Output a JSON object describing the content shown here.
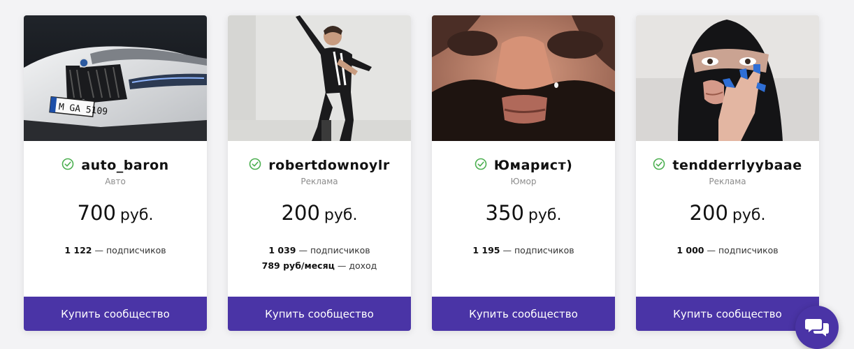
{
  "currency": "руб.",
  "button_label": "Купить сообщество",
  "cards": [
    {
      "name": "auto_baron",
      "category": "Авто",
      "price": "700",
      "stats": [
        {
          "value": "1 122",
          "label": "— подписчиков"
        }
      ]
    },
    {
      "name": "robertdownoylr",
      "category": "Реклама",
      "price": "200",
      "stats": [
        {
          "value": "1 039",
          "label": "— подписчиков"
        },
        {
          "value": "789 руб/месяц",
          "label": "— доход"
        }
      ]
    },
    {
      "name": "Юмарист)",
      "category": "Юмор",
      "price": "350",
      "stats": [
        {
          "value": "1 195",
          "label": "— подписчиков"
        }
      ]
    },
    {
      "name": "tendderrlyybaae",
      "category": "Реклама",
      "price": "200",
      "stats": [
        {
          "value": "1 000",
          "label": "— подписчиков"
        }
      ]
    }
  ],
  "icons": {
    "verified": "check-circle-icon",
    "chat": "chat-bubbles-icon"
  },
  "colors": {
    "accent": "#4a34a6",
    "verified": "#4caf50"
  }
}
